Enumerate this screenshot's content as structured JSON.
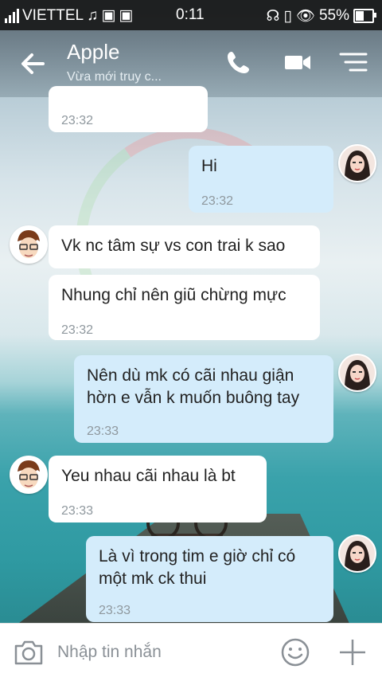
{
  "status_bar": {
    "carrier": "VIETTEL",
    "time": "0:11",
    "battery": "55%"
  },
  "header": {
    "contact_name": "Apple",
    "subtitle": "Vừa mới truy c...",
    "icons": [
      "back-arrow-icon",
      "phone-icon",
      "video-camera-icon",
      "menu-icon"
    ]
  },
  "messages": [
    {
      "side": "incoming",
      "text": "",
      "time": "23:32"
    },
    {
      "side": "outgoing",
      "text": "Hi",
      "time": "23:32"
    },
    {
      "side": "incoming",
      "text": "Vk nc tâm sự vs con trai k sao",
      "time": ""
    },
    {
      "side": "incoming",
      "text": "Nhung chỉ nên giũ chừng mực",
      "time": "23:32"
    },
    {
      "side": "outgoing",
      "text": "Nên dù mk có cãi nhau giận hờn e vẫn k muốn buông tay",
      "time": "23:33"
    },
    {
      "side": "incoming",
      "text": "Yeu nhau cãi nhau là bt",
      "time": "23:33"
    },
    {
      "side": "outgoing",
      "text": "Là vì trong tim e giờ chỉ có một mk ck thui",
      "time": "23:33"
    }
  ],
  "input": {
    "placeholder": "Nhập tin nhắn",
    "icons": [
      "camera-icon",
      "emoji-icon",
      "plus-icon"
    ]
  }
}
